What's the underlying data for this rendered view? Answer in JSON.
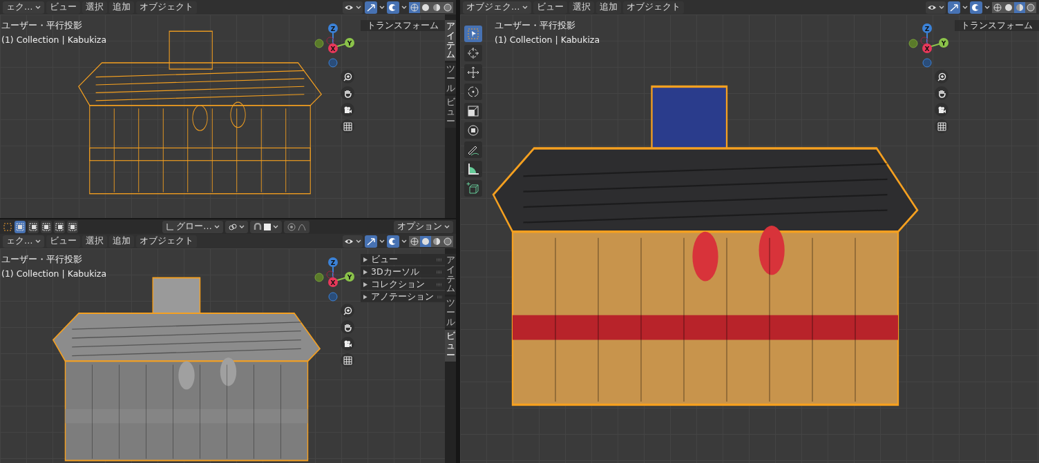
{
  "viewports": [
    {
      "mode": "ェク…",
      "menus": [
        "ビュー",
        "選択",
        "追加",
        "オブジェクト"
      ],
      "shading_buttons": [
        {
          "kind": "wireframe",
          "selected": true
        },
        {
          "kind": "solid",
          "selected": false
        },
        {
          "kind": "material",
          "selected": false
        },
        {
          "kind": "rendered",
          "selected": false
        }
      ],
      "view_label": "ユーザー・平行投影",
      "collection_label": "(1) Collection | Kabukiza",
      "gizmo_axes": [
        "Z",
        "X",
        "Y"
      ],
      "sidebar": {
        "panels": [
          "トランスフォーム"
        ],
        "tabs": [
          {
            "label": "アイテム",
            "selected": true
          },
          {
            "label": "ツール",
            "selected": false
          },
          {
            "label": "ビュー",
            "selected": false
          }
        ]
      }
    },
    {
      "tool_header": {
        "orientation": "グロー…",
        "options": "オプション"
      },
      "mode": "ェク…",
      "menus": [
        "ビュー",
        "選択",
        "追加",
        "オブジェクト"
      ],
      "shading_buttons": [
        {
          "kind": "wireframe",
          "selected": false
        },
        {
          "kind": "solid",
          "selected": true
        },
        {
          "kind": "material",
          "selected": false
        },
        {
          "kind": "rendered",
          "selected": false
        }
      ],
      "view_label": "ユーザー・平行投影",
      "collection_label": "(1) Collection | Kabukiza",
      "gizmo_axes": [
        "Z",
        "X",
        "Y"
      ],
      "sidebar": {
        "panels": [
          "ビュー",
          "3Dカーソル",
          "コレクション",
          "アノテーション"
        ],
        "tabs": [
          {
            "label": "アイテム",
            "selected": false
          },
          {
            "label": "ツール",
            "selected": false
          },
          {
            "label": "ビュー",
            "selected": true
          }
        ]
      }
    },
    {
      "mode": "オブジェク…",
      "menus": [
        "ビュー",
        "選択",
        "追加",
        "オブジェクト"
      ],
      "shading_buttons": [
        {
          "kind": "wireframe",
          "selected": false
        },
        {
          "kind": "solid",
          "selected": false
        },
        {
          "kind": "material",
          "selected": true
        },
        {
          "kind": "rendered",
          "selected": false
        }
      ],
      "view_label": "ユーザー・平行投影",
      "collection_label": "(1) Collection | Kabukiza",
      "gizmo_axes": [
        "Z",
        "X",
        "Y"
      ],
      "sidebar": {
        "panels": [
          "トランスフォーム"
        ]
      },
      "tools": [
        {
          "kind": "select",
          "selected": true
        },
        {
          "kind": "cursor",
          "selected": false
        },
        {
          "kind": "move",
          "selected": false
        },
        {
          "kind": "rotate",
          "selected": false
        },
        {
          "kind": "scale",
          "selected": false
        },
        {
          "kind": "transform",
          "selected": false
        },
        {
          "kind": "annotate",
          "selected": false
        },
        {
          "kind": "measure",
          "selected": false
        },
        {
          "kind": "add-cube",
          "selected": false
        }
      ]
    }
  ]
}
